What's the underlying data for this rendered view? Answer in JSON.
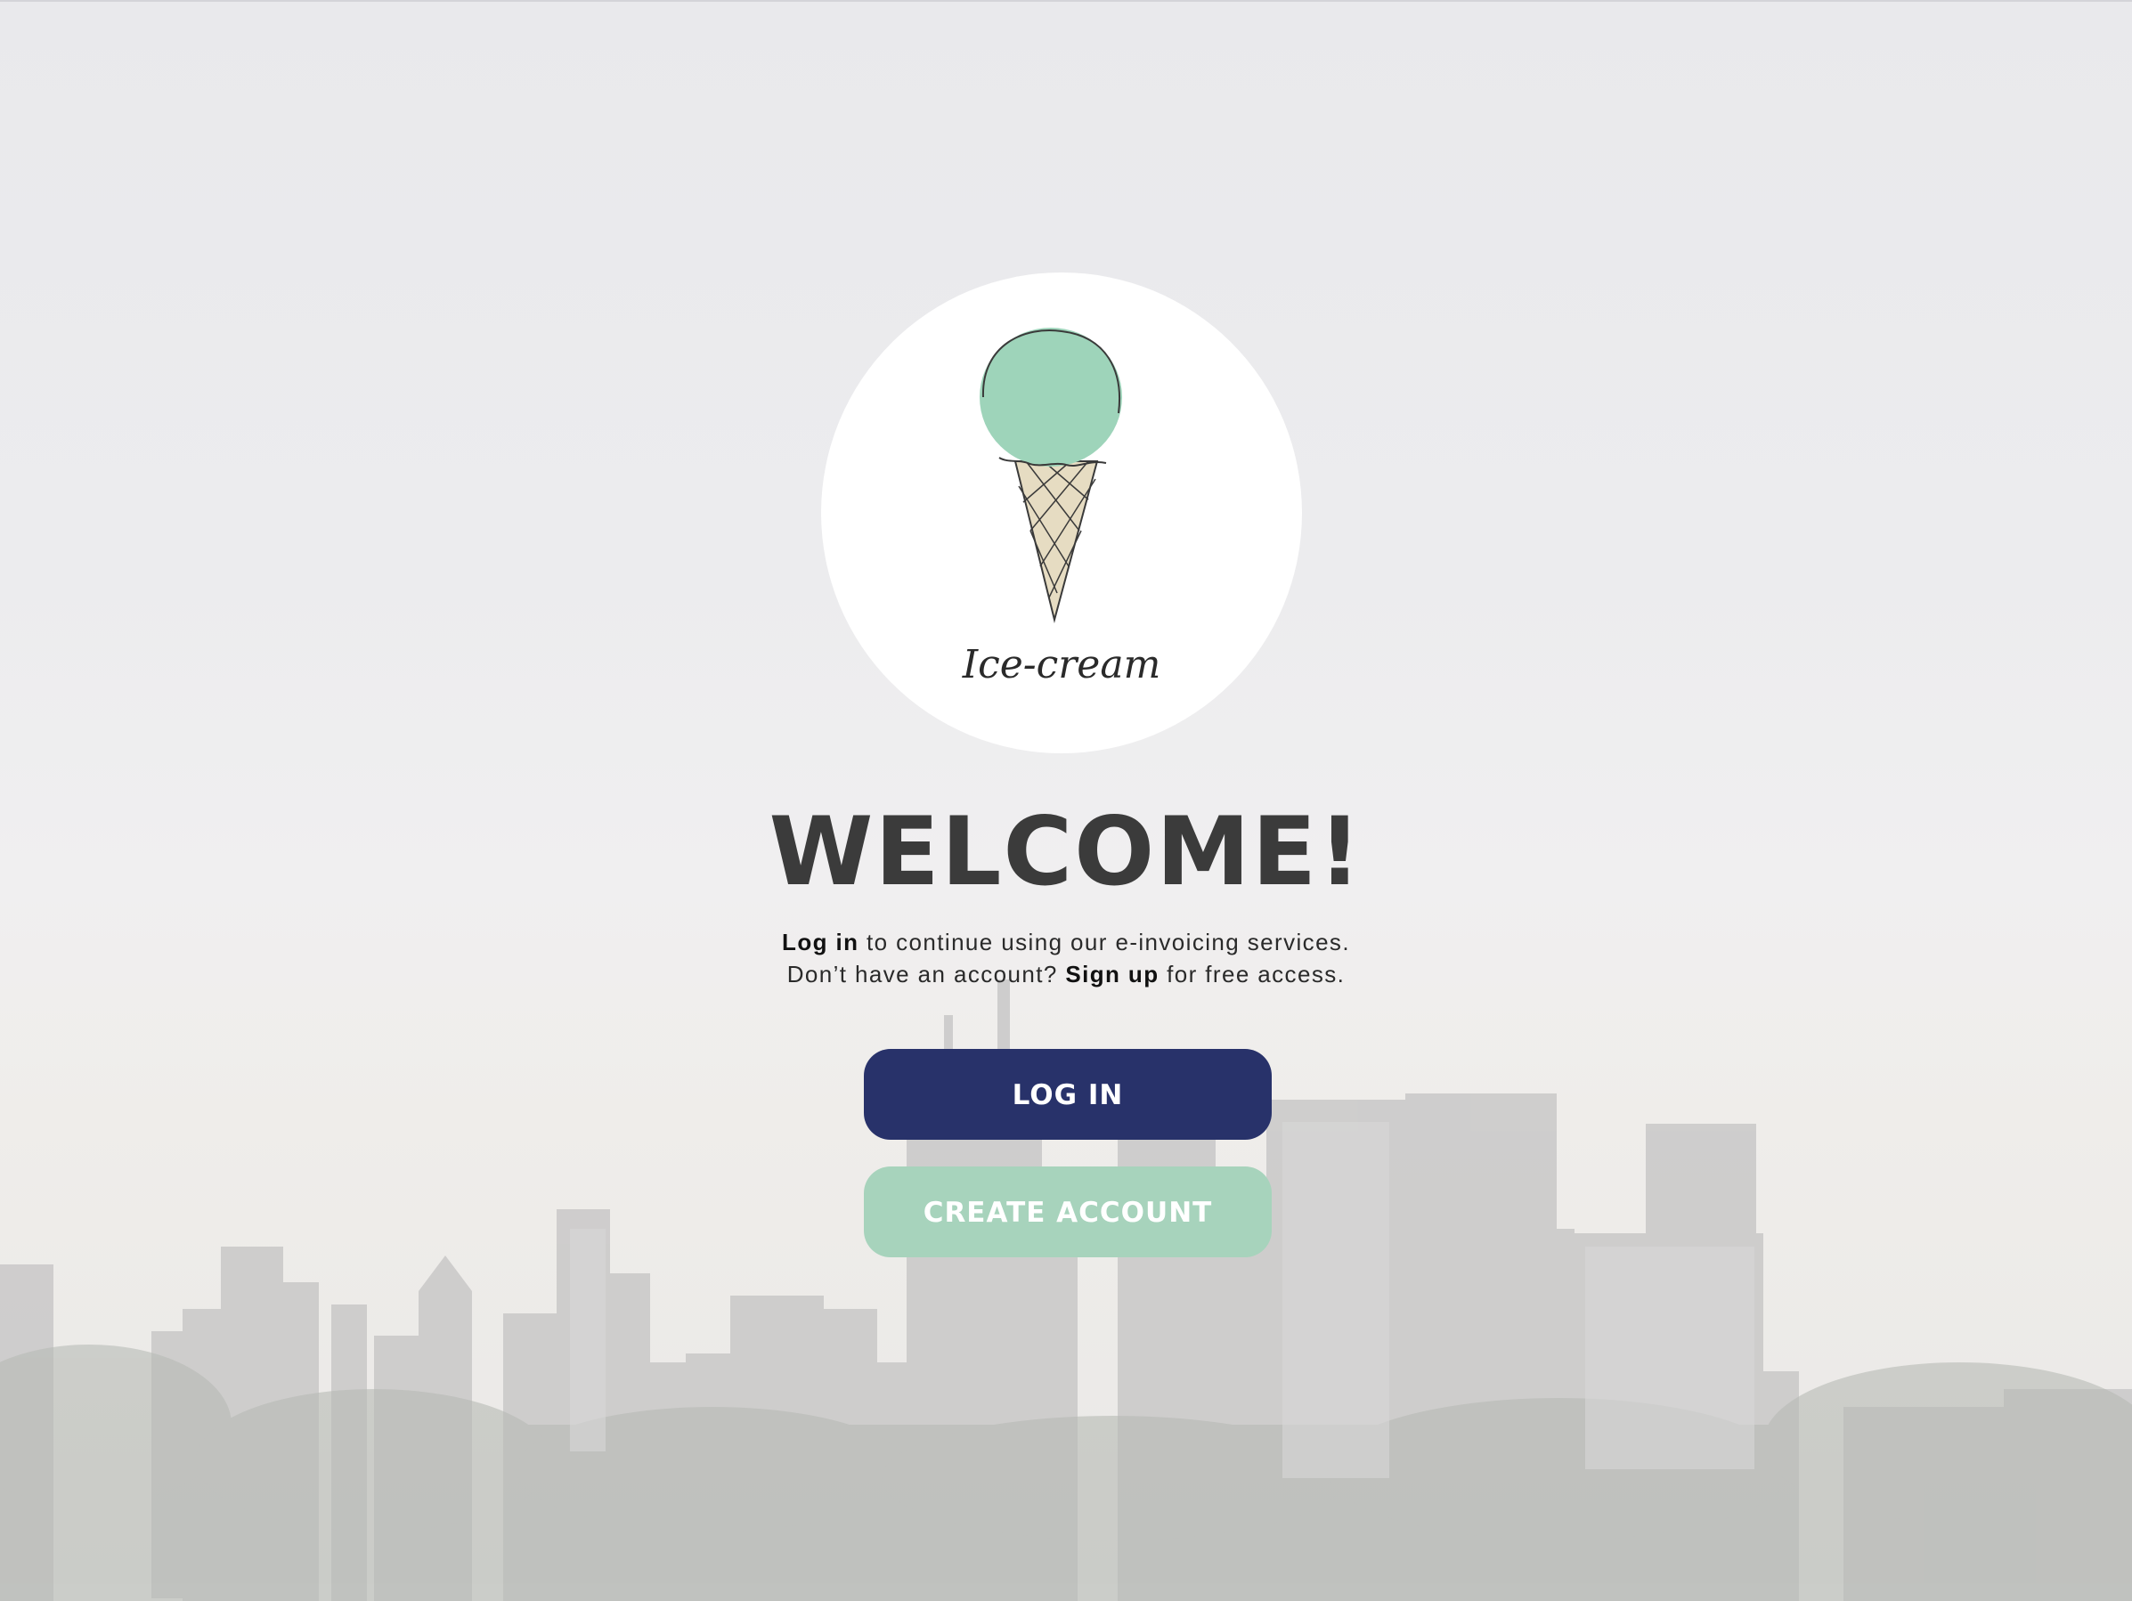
{
  "brand": {
    "logo_text": "Ice-cream"
  },
  "welcome": {
    "title": "WELCOME!",
    "line1_bold": "Log in",
    "line1_rest": " to continue using our e-invoicing services.",
    "line2_start": "Don’t have an account? ",
    "line2_bold": "Sign up",
    "line2_rest": " for free access."
  },
  "actions": {
    "login_label": "LOG IN",
    "create_label": "CREATE ACCOUNT"
  },
  "colors": {
    "login_button": "#28326a",
    "create_button": "#a7d3bc",
    "scoop": "#9ed4ba",
    "cone": "#e6dcc2",
    "title": "#3b3b3b"
  },
  "icons": {
    "logo": "ice-cream-cone-icon"
  }
}
